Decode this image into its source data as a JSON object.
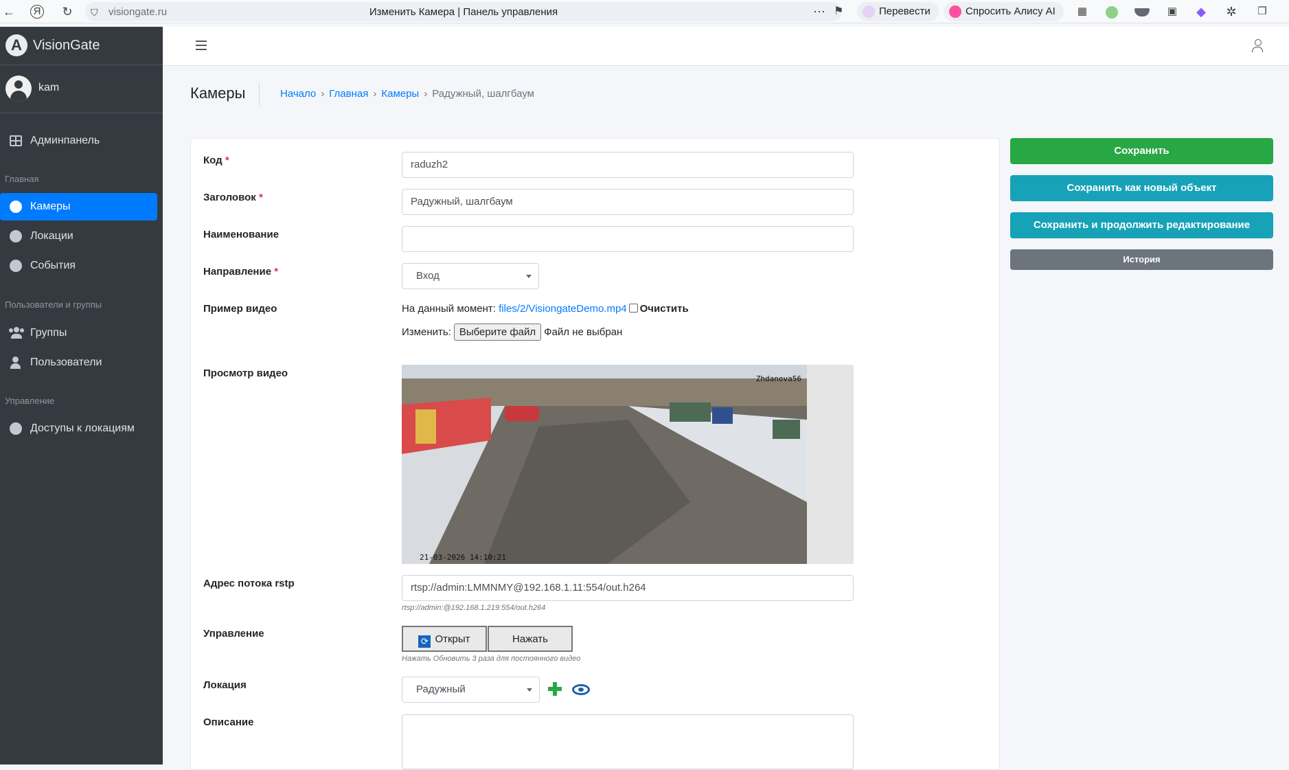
{
  "browser": {
    "url": "visiongate.ru",
    "tab_title": "Изменить Камера | Панель управления",
    "translate_label": "Перевести",
    "alice_label": "Спросить Алису AI"
  },
  "sidebar": {
    "brand": "VisionGate",
    "username": "kam",
    "admin_label": "Админпанель",
    "section_main": "Главная",
    "section_users": "Пользователи и группы",
    "section_manage": "Управление",
    "items": [
      {
        "label": "Камеры"
      },
      {
        "label": "Локации"
      },
      {
        "label": "События"
      },
      {
        "label": "Группы"
      },
      {
        "label": "Пользователи"
      },
      {
        "label": "Доступы к локациям"
      }
    ]
  },
  "header": {
    "title": "Камеры",
    "breadcrumb": [
      "Начало",
      "Главная",
      "Камеры",
      "Радужный, шалгбаум"
    ]
  },
  "form": {
    "code_label": "Код",
    "code_value": "raduzh2",
    "title_label": "Заголовок",
    "title_value": "Радужный, шалгбаум",
    "name_label": "Наименование",
    "name_value": "",
    "direction_label": "Направление",
    "direction_value": "Вход",
    "video_label": "Пример видео",
    "current_prefix": "На данный момент:",
    "current_file": "files/2/VisiongateDemo.mp4",
    "clear_label": "Очистить",
    "change_prefix": "Изменить:",
    "choose_file": "Выберите файл",
    "no_file": "Файл не выбран",
    "preview_label": "Просмотр видео",
    "preview_overlay_name": "Zhdanova56",
    "preview_overlay_time": "21-03-2026 14:10:21",
    "rtsp_label": "Адрес потока rstp",
    "rtsp_value": "rtsp://admin:LMMNMY@192.168.1.11:554/out.h264",
    "rtsp_help": "rtsp://admin:@192.168.1.219:554/out.h264",
    "control_label": "Управление",
    "open_button": "Открыт",
    "press_button": "Нажать",
    "control_help": "Нажать Обновить 3 раза для постоянного видео",
    "location_label": "Локация",
    "location_value": "Радужный",
    "description_label": "Описание",
    "required_mark": "*"
  },
  "actions": {
    "save": "Сохранить",
    "save_as_new": "Сохранить как новый объект",
    "save_continue": "Сохранить и продолжить редактирование",
    "history": "История"
  },
  "colors": {
    "sidebar_bg": "#343a40",
    "accent": "#007bff",
    "save": "#28a745",
    "secondary_action": "#17a2b8",
    "history": "#6c757d",
    "required": "#dc3545"
  }
}
